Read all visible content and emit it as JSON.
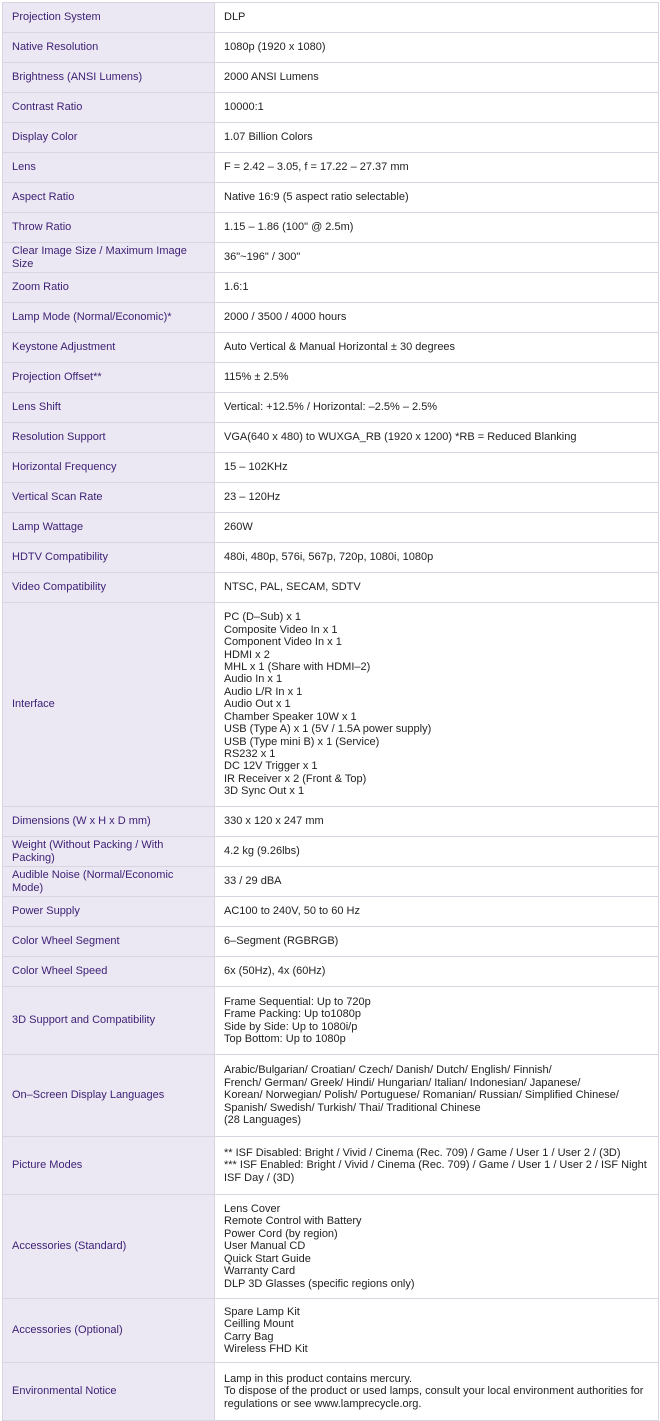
{
  "rows": [
    {
      "label": "Projection System",
      "lines": [
        "DLP"
      ]
    },
    {
      "label": "Native Resolution",
      "lines": [
        "1080p (1920 x 1080)"
      ]
    },
    {
      "label": "Brightness (ANSI Lumens)",
      "lines": [
        "2000 ANSI Lumens"
      ]
    },
    {
      "label": "Contrast Ratio",
      "lines": [
        "10000:1"
      ]
    },
    {
      "label": "Display Color",
      "lines": [
        "1.07 Billion Colors"
      ]
    },
    {
      "label": "Lens",
      "lines": [
        "F = 2.42 – 3.05, f = 17.22 – 27.37 mm"
      ]
    },
    {
      "label": "Aspect Ratio",
      "lines": [
        "Native 16:9 (5 aspect ratio selectable)"
      ]
    },
    {
      "label": "Throw Ratio",
      "lines": [
        "1.15 – 1.86 (100\" @ 2.5m)"
      ]
    },
    {
      "label": "Clear Image Size / Maximum Image Size",
      "lines": [
        "36\"~196\" / 300\""
      ]
    },
    {
      "label": "Zoom Ratio",
      "lines": [
        "1.6:1"
      ]
    },
    {
      "label": "Lamp Mode (Normal/Economic)*",
      "lines": [
        "2000 / 3500 / 4000 hours"
      ]
    },
    {
      "label": "Keystone Adjustment",
      "lines": [
        "Auto Vertical & Manual Horizontal ± 30 degrees"
      ]
    },
    {
      "label": "Projection Offset**",
      "lines": [
        "115% ± 2.5%"
      ]
    },
    {
      "label": "Lens Shift",
      "lines": [
        "Vertical: +12.5% / Horizontal: –2.5% – 2.5%"
      ]
    },
    {
      "label": "Resolution Support",
      "lines": [
        "VGA(640 x 480) to WUXGA_RB (1920 x 1200) *RB = Reduced Blanking"
      ]
    },
    {
      "label": "Horizontal Frequency",
      "lines": [
        "15 – 102KHz"
      ]
    },
    {
      "label": "Vertical Scan Rate",
      "lines": [
        "23 – 120Hz"
      ]
    },
    {
      "label": "Lamp Wattage",
      "lines": [
        "260W"
      ]
    },
    {
      "label": "HDTV Compatibility",
      "lines": [
        "480i, 480p, 576i, 567p, 720p, 1080i, 1080p"
      ]
    },
    {
      "label": "Video Compatibility",
      "lines": [
        "NTSC, PAL, SECAM, SDTV"
      ]
    },
    {
      "label": "Interface",
      "lines": [
        "PC (D–Sub) x 1",
        "Composite Video In x 1",
        "Component Video In x 1",
        "HDMI x 2",
        "MHL x 1 (Share with HDMI–2)",
        "Audio In x 1",
        "Audio L/R In x 1",
        "Audio Out x 1",
        "Chamber Speaker 10W x 1",
        "USB (Type A) x 1 (5V / 1.5A power supply)",
        "USB (Type mini B) x 1 (Service)",
        "RS232 x 1",
        "DC 12V Trigger x 1",
        "IR Receiver x 2 (Front & Top)",
        "3D Sync Out x 1"
      ]
    },
    {
      "label": "Dimensions (W x H x D mm)",
      "lines": [
        "330 x 120 x 247 mm"
      ]
    },
    {
      "label": "Weight (Without Packing / With Packing)",
      "lines": [
        "4.2 kg (9.26lbs)"
      ]
    },
    {
      "label": "Audible Noise (Normal/Economic Mode)",
      "lines": [
        "33 / 29 dBA"
      ]
    },
    {
      "label": "Power Supply",
      "lines": [
        "AC100 to 240V, 50 to 60 Hz"
      ]
    },
    {
      "label": "Color Wheel Segment",
      "lines": [
        "6–Segment (RGBRGB)"
      ]
    },
    {
      "label": "Color Wheel Speed",
      "lines": [
        "6x (50Hz), 4x (60Hz)"
      ]
    },
    {
      "label": "3D Support and Compatibility",
      "lines": [
        "Frame Sequential: Up to 720p",
        "Frame Packing: Up to1080p",
        "Side by Side: Up to 1080i/p",
        "Top Bottom: Up to 1080p"
      ]
    },
    {
      "label": "On–Screen Display Languages",
      "lines": [
        "Arabic/Bulgarian/ Croatian/ Czech/ Danish/ Dutch/ English/ Finnish/",
        "French/ German/ Greek/ Hindi/ Hungarian/ Italian/ Indonesian/ Japanese/",
        "Korean/ Norwegian/ Polish/ Portuguese/ Romanian/ Russian/ Simplified Chinese/",
        "Spanish/ Swedish/ Turkish/ Thai/ Traditional Chinese",
        "(28 Languages)"
      ]
    },
    {
      "label": "Picture Modes",
      "lines": [
        "** ISF Disabled: Bright / Vivid / Cinema (Rec. 709) / Game / User 1 / User 2 / (3D)",
        "*** ISF Enabled: Bright / Vivid / Cinema (Rec. 709) / Game / User 1 / User 2 / ISF Night",
        "ISF Day / (3D)"
      ]
    },
    {
      "label": "Accessories (Standard)",
      "lines": [
        "Lens Cover",
        "Remote Control with Battery",
        "Power Cord (by region)",
        "User Manual CD",
        "Quick Start Guide",
        "Warranty Card",
        "DLP 3D Glasses (specific regions only)"
      ]
    },
    {
      "label": "Accessories (Optional)",
      "lines": [
        "Spare Lamp Kit",
        "Ceilling Mount",
        "Carry Bag",
        "Wireless FHD Kit"
      ]
    },
    {
      "label": "Environmental Notice",
      "lines": [
        "Lamp in this product contains mercury.",
        "To dispose of the product or used lamps, consult your local environment authorities for",
        "regulations or see www.lamprecycle.org."
      ]
    }
  ]
}
